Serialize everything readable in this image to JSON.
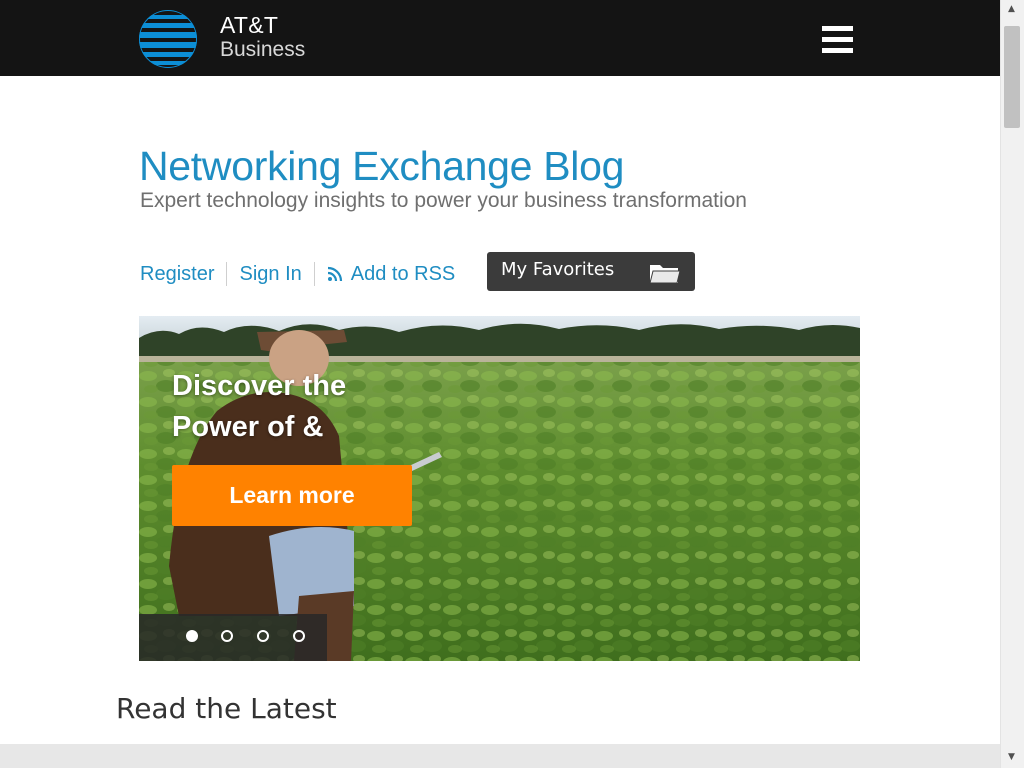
{
  "header": {
    "brand_line1": "AT&T",
    "brand_line2": "Business",
    "background_color": "#141414",
    "logo_color": "#0c8ed6",
    "menu_icon": "hamburger-menu-icon"
  },
  "blog": {
    "title": "Networking Exchange Blog",
    "subtitle": "Expert technology insights to power your business transformation",
    "title_color": "#1f8dc2"
  },
  "links": {
    "register": "Register",
    "sign_in": "Sign In",
    "rss": "Add to RSS",
    "rss_icon": "rss-icon",
    "favorites": "My Favorites",
    "favorites_icon": "folder-icon"
  },
  "hero": {
    "heading": "Discover the Power of &",
    "button_label": "Learn more",
    "button_color": "#ff8200",
    "carousel_count": 4,
    "carousel_active": 1
  },
  "section": {
    "heading": "Read the Latest"
  }
}
